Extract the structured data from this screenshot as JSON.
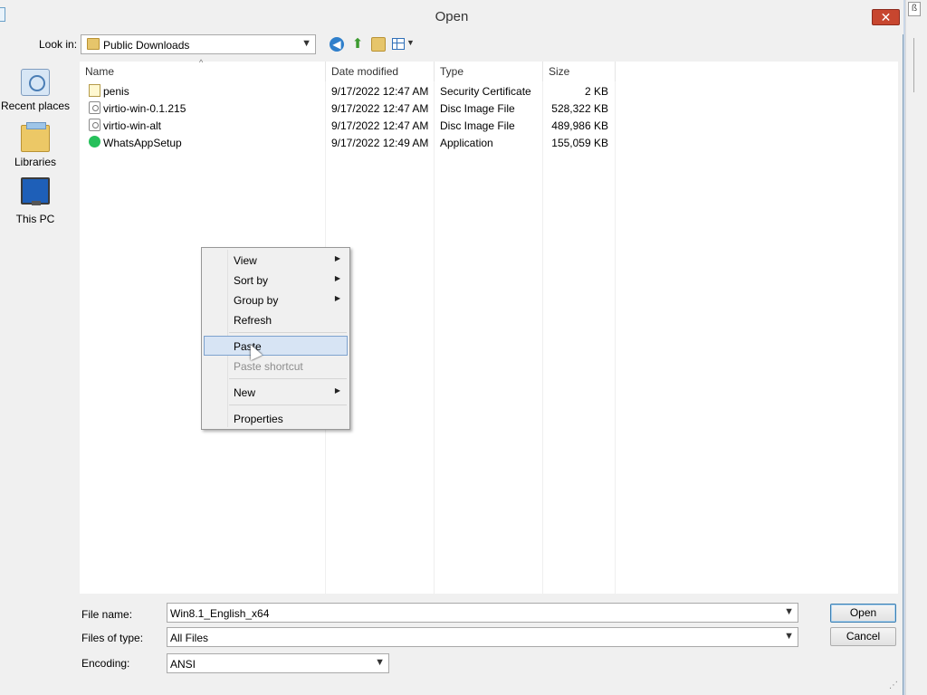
{
  "window": {
    "title": "Open",
    "close_glyph": "✕"
  },
  "toolbar": {
    "look_in_label": "Look in:",
    "look_in_value": "Public Downloads",
    "icons": [
      "back-icon",
      "up-folder-icon",
      "new-folder-icon",
      "views-menu-icon"
    ]
  },
  "places": [
    {
      "label": "Recent places",
      "icon": "recent-places-icon"
    },
    {
      "label": "Libraries",
      "icon": "libraries-icon"
    },
    {
      "label": "This PC",
      "icon": "this-pc-icon"
    }
  ],
  "columns": {
    "name": "Name",
    "date": "Date modified",
    "type": "Type",
    "size": "Size"
  },
  "files": [
    {
      "name": "penis",
      "date": "9/17/2022 12:47 AM",
      "type": "Security Certificate",
      "size": "2 KB",
      "icon": "certificate-icon"
    },
    {
      "name": "virtio-win-0.1.215",
      "date": "9/17/2022 12:47 AM",
      "type": "Disc Image File",
      "size": "528,322 KB",
      "icon": "disc-image-icon"
    },
    {
      "name": "virtio-win-alt",
      "date": "9/17/2022 12:47 AM",
      "type": "Disc Image File",
      "size": "489,986 KB",
      "icon": "disc-image-icon"
    },
    {
      "name": "WhatsAppSetup",
      "date": "9/17/2022 12:49 AM",
      "type": "Application",
      "size": "155,059 KB",
      "icon": "whatsapp-icon"
    }
  ],
  "context_menu": {
    "items": [
      {
        "label": "View",
        "submenu": true
      },
      {
        "label": "Sort by",
        "submenu": true
      },
      {
        "label": "Group by",
        "submenu": true
      },
      {
        "label": "Refresh"
      },
      {
        "label": "Paste",
        "highlighted": true
      },
      {
        "label": "Paste shortcut",
        "disabled": true
      },
      {
        "label": "New",
        "submenu": true
      },
      {
        "label": "Properties"
      }
    ]
  },
  "form": {
    "file_name_label": "File name:",
    "file_name_value": "Win8.1_English_x64",
    "file_type_label": "Files of type:",
    "file_type_value": "All Files",
    "encoding_label": "Encoding:",
    "encoding_value": "ANSI"
  },
  "buttons": {
    "open": "Open",
    "cancel": "Cancel"
  },
  "colors": {
    "highlight": "#d7e4f4",
    "close": "#c7462f"
  }
}
